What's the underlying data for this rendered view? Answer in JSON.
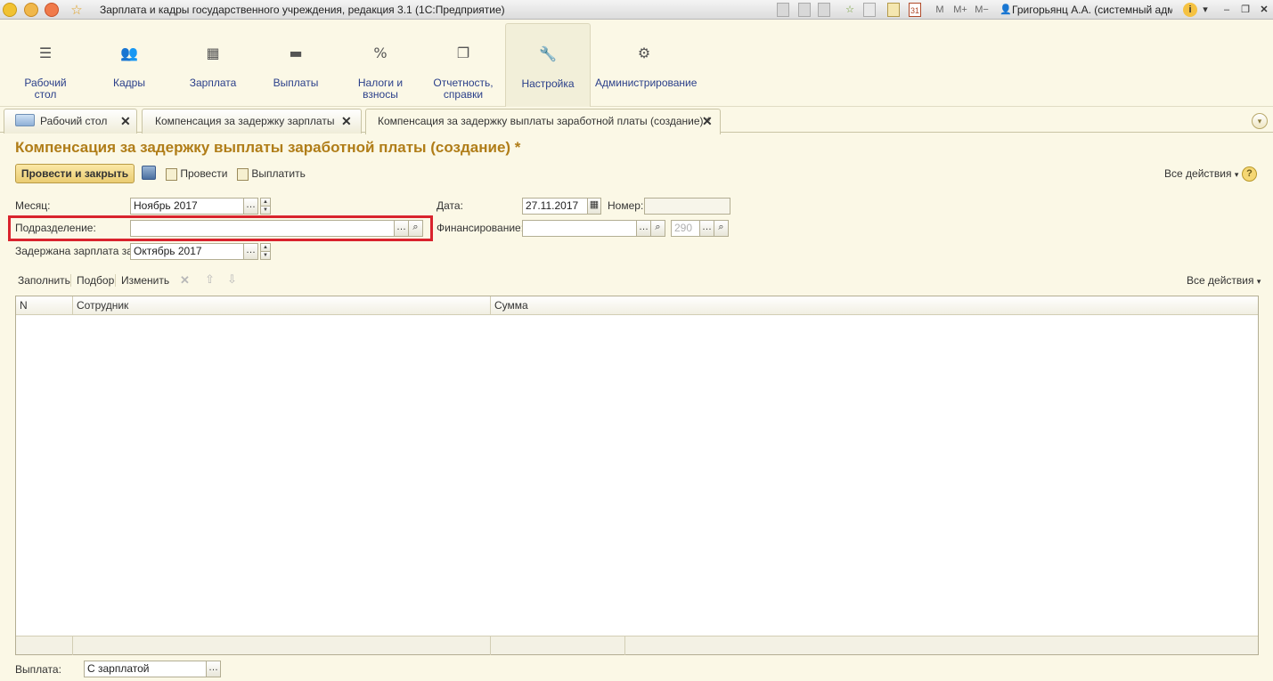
{
  "window": {
    "title": "Зарплата и кадры государственного учреждения, редакция 3.1  (1С:Предприятие)",
    "user": "Григорьянц А.А. (системный адм...",
    "mem_buttons": [
      "M",
      "M+",
      "M−"
    ]
  },
  "sections": [
    {
      "icon": "desktop-icon",
      "label_1": "Рабочий",
      "label_2": "стол"
    },
    {
      "icon": "people-icon",
      "label_1": "Кадры",
      "label_2": ""
    },
    {
      "icon": "calculator-icon",
      "label_1": "Зарплата",
      "label_2": ""
    },
    {
      "icon": "wallet-icon",
      "label_1": "Выплаты",
      "label_2": ""
    },
    {
      "icon": "percent-icon",
      "label_1": "Налоги и",
      "label_2": "взносы"
    },
    {
      "icon": "reports-icon",
      "label_1": "Отчетность,",
      "label_2": "справки"
    },
    {
      "icon": "wrench-icon",
      "label_1": "Настройка",
      "label_2": ""
    },
    {
      "icon": "gear-icon",
      "label_1": "Администрирование",
      "label_2": ""
    }
  ],
  "tabs": [
    {
      "label": "Рабочий стол"
    },
    {
      "label": "Компенсация за задержку зарплаты"
    },
    {
      "label": "Компенсация за задержку выплаты заработной платы (создание) *"
    }
  ],
  "form": {
    "title": "Компенсация за задержку выплаты заработной платы (создание) *",
    "buttons": {
      "post_close": "Провести и закрыть",
      "post": "Провести",
      "pay": "Выплатить",
      "all_actions": "Все действия"
    },
    "fields": {
      "month_label": "Месяц:",
      "month_value": "Ноябрь 2017",
      "date_label": "Дата:",
      "date_value": "27.11.2017",
      "number_label": "Номер:",
      "number_value": "",
      "department_label": "Подразделение:",
      "department_value": "",
      "financing_label": "Финансирование:",
      "financing_value": "",
      "code_placeholder": "290",
      "delayed_label": "Задержана зарплата за:",
      "delayed_value": "Октябрь 2017",
      "payout_label": "Выплата:",
      "payout_value": "С зарплатой"
    },
    "table_toolbar": {
      "fill": "Заполнить",
      "pick": "Подбор",
      "edit": "Изменить",
      "all_actions": "Все действия"
    },
    "table": {
      "columns": [
        "N",
        "Сотрудник",
        "Сумма"
      ],
      "rows": []
    }
  }
}
